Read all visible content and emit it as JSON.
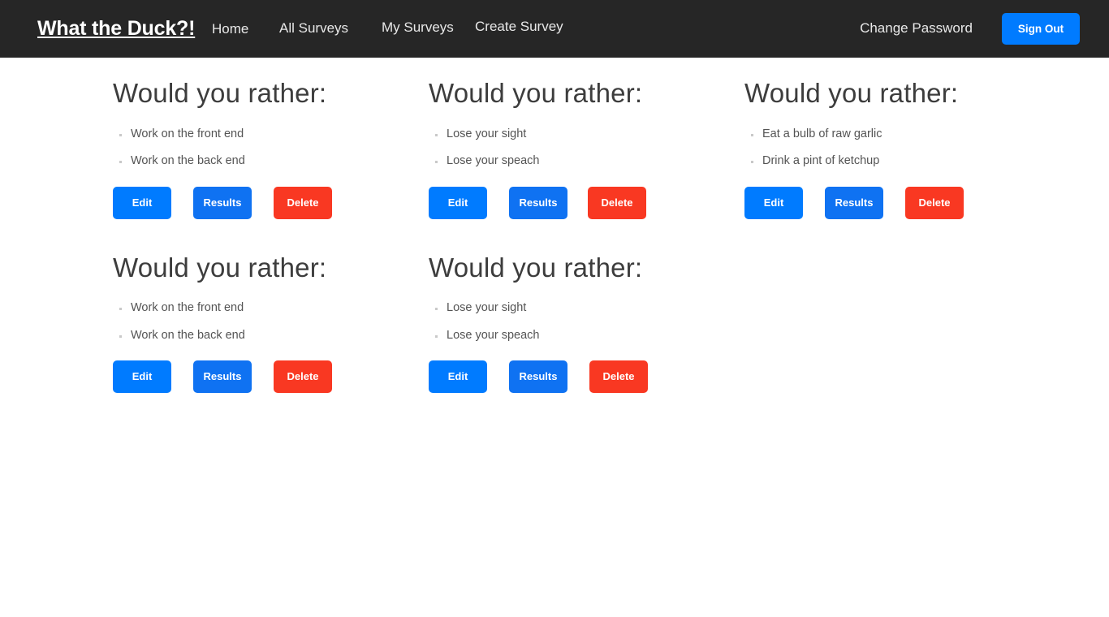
{
  "navbar": {
    "brand": "What the Duck?!",
    "links": [
      {
        "label": "Home"
      },
      {
        "label": "All Surveys"
      },
      {
        "label": "My Surveys"
      },
      {
        "label": "Create Survey"
      }
    ],
    "change_password_label": "Change Password",
    "sign_out_label": "Sign Out",
    "background_color": "#262626",
    "accent_color": "#007bff"
  },
  "buttons": {
    "edit_label": "Edit",
    "results_label": "Results",
    "delete_label": "Delete",
    "primary_color": "#007bff",
    "danger_color": "#f93822"
  },
  "surveys": [
    {
      "title": "Would you rather:",
      "options": [
        "Work on the front end",
        "Work on the back end"
      ]
    },
    {
      "title": "Would you rather:",
      "options": [
        "Lose your sight",
        "Lose your speach"
      ]
    },
    {
      "title": "Would you rather:",
      "options": [
        "Eat a bulb of raw garlic",
        "Drink a pint of ketchup"
      ]
    },
    {
      "title": "Would you rather:",
      "options": [
        "Work on the front end",
        "Work on the back end"
      ]
    },
    {
      "title": "Would you rather:",
      "options": [
        "Lose your sight",
        "Lose your speach"
      ]
    }
  ]
}
